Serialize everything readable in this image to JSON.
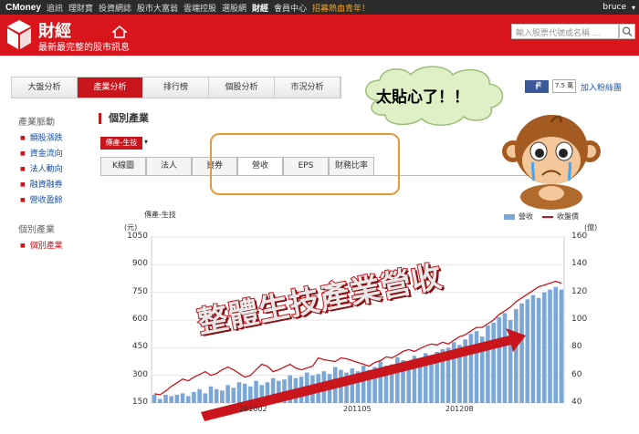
{
  "topbar": {
    "brand": "CMoney",
    "nav": [
      "追訊",
      "理財寶",
      "投資網誌",
      "股市大富翁",
      "雲端控股",
      "選股網",
      "財經",
      "會員中心"
    ],
    "active_nav": "財經",
    "recruit": "招募熱血青年！",
    "user": "bruce"
  },
  "header": {
    "title": "財經",
    "subtitle": "最新最完整的股市訊息",
    "search_placeholder": "輸入股票代號或名稱 ..."
  },
  "subnav": [
    "大盤分析",
    "產業分析",
    "排行榜",
    "個股分析",
    "市況分析"
  ],
  "subnav_active": "產業分析",
  "social": {
    "fb_label": "f",
    "fb_sub": "讚",
    "count": "7.5 萬",
    "fan_link": "加入粉絲團"
  },
  "sidebar": {
    "group1_title": "產業脈動",
    "group1_items": [
      "類股漲跌",
      "資金流向",
      "法人動向",
      "融資融券",
      "營收盈餘"
    ],
    "group2_title": "個別產業",
    "group2_items": [
      "個別產業"
    ]
  },
  "main": {
    "section_title": "個別產業",
    "industry_select": "傳產-生技",
    "tabs": [
      "K線圖",
      "法人",
      "資券",
      "營收",
      "EPS",
      "財務比率"
    ],
    "active_tab": "營收"
  },
  "bubble_text": "太貼心了！！",
  "overlay_text": "整體生技產業營收",
  "chart_data": {
    "type": "bar",
    "title": "傳產-生技",
    "ylabel": "(元)",
    "y2label": "(億)",
    "ylim": [
      150,
      1050
    ],
    "y2lim": [
      40,
      160
    ],
    "yticks": [
      150,
      300,
      450,
      600,
      750,
      900,
      1050
    ],
    "y2ticks": [
      40,
      60,
      80,
      100,
      120,
      140,
      160
    ],
    "xticks": [
      "201002",
      "201105",
      "201208"
    ],
    "legend": [
      "營收",
      "收盤價"
    ],
    "legend_position": "top-right",
    "colors": {
      "bars": "#7ba7d7",
      "line": "#c9161c"
    },
    "series": [
      {
        "name": "營收",
        "axis": "right",
        "values": [
          46,
          43,
          46,
          45,
          46,
          47,
          45,
          48,
          50,
          47,
          52,
          50,
          49,
          53,
          51,
          55,
          54,
          52,
          56,
          53,
          55,
          58,
          56,
          57,
          60,
          58,
          59,
          62,
          60,
          61,
          63,
          61,
          66,
          64,
          62,
          65,
          63,
          67,
          64,
          66,
          70,
          67,
          68,
          73,
          71,
          69,
          74,
          72,
          76,
          74,
          77,
          79,
          80,
          84,
          82,
          86,
          90,
          92,
          88,
          96,
          98,
          102,
          105,
          100,
          108,
          112,
          115,
          118,
          116,
          120,
          122,
          124,
          122
        ]
      },
      {
        "name": "收盤價",
        "axis": "left",
        "values": [
          200,
          195,
          215,
          240,
          260,
          280,
          270,
          290,
          305,
          320,
          300,
          310,
          330,
          345,
          330,
          310,
          290,
          300,
          330,
          360,
          350,
          320,
          330,
          345,
          360,
          340,
          330,
          340,
          350,
          395,
          385,
          380,
          375,
          395,
          390,
          380,
          370,
          360,
          350,
          370,
          380,
          400,
          395,
          410,
          430,
          440,
          430,
          445,
          460,
          470,
          465,
          480,
          470,
          490,
          510,
          520,
          540,
          560,
          560,
          580,
          600,
          630,
          650,
          670,
          700,
          720,
          740,
          760,
          780,
          790,
          800,
          810,
          800
        ]
      }
    ]
  }
}
